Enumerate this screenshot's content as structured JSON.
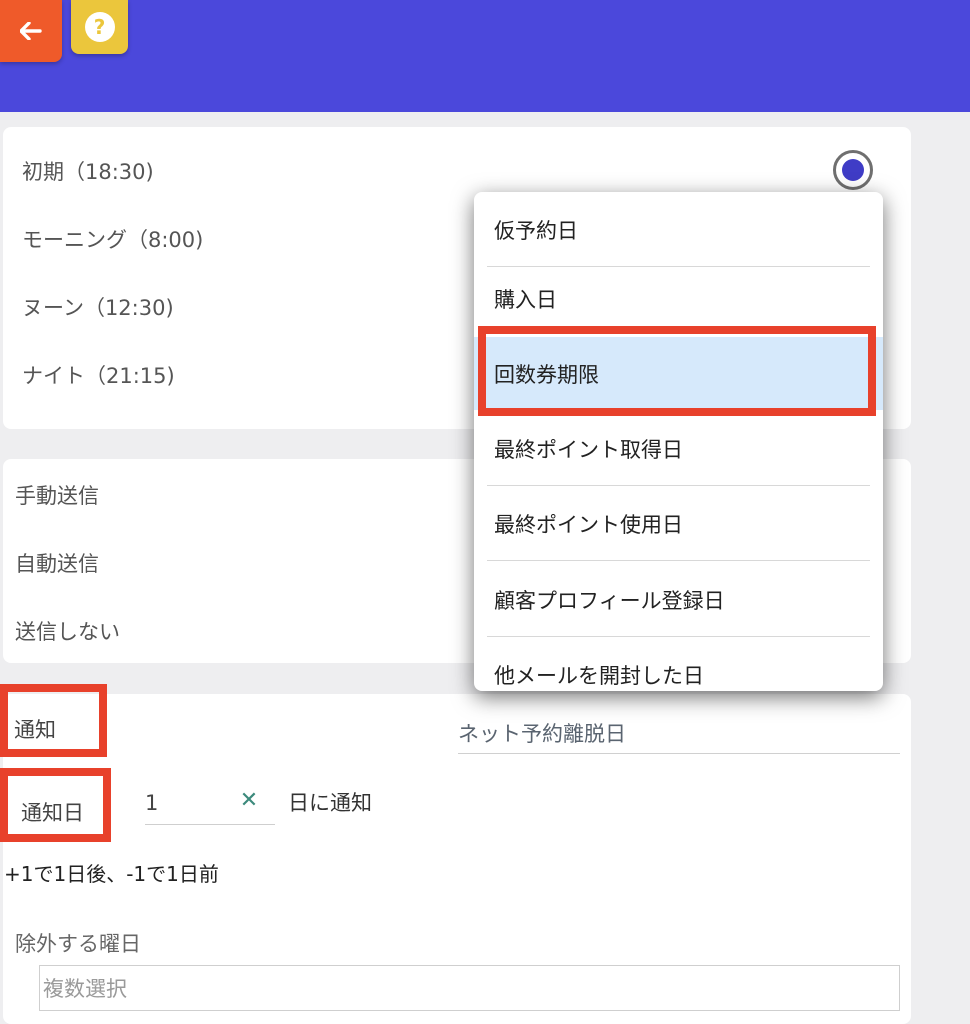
{
  "header": {
    "back_icon": "arrow-left-icon",
    "help_icon": "question-circle-icon",
    "help_glyph": "?",
    "colors": {
      "bar": "#4b48db",
      "back": "#ef5a2a",
      "help": "#ebc63c"
    }
  },
  "timing_options": [
    {
      "label": "初期（18:30)",
      "selected": true
    },
    {
      "label": "モーニング（8:00)",
      "selected": false
    },
    {
      "label": "ヌーン（12:30)",
      "selected": false
    },
    {
      "label": "ナイト（21:15)",
      "selected": false
    }
  ],
  "send_options": [
    {
      "label": "手動送信"
    },
    {
      "label": "自動送信"
    },
    {
      "label": "送信しない"
    }
  ],
  "dropdown": {
    "items": [
      {
        "label": "仮予約日"
      },
      {
        "label": "購入日"
      },
      {
        "label": "回数券期限",
        "selected": true
      },
      {
        "label": "最終ポイント取得日"
      },
      {
        "label": "最終ポイント使用日"
      },
      {
        "label": "顧客プロフィール登録日"
      },
      {
        "label": "他メールを開封した日"
      }
    ],
    "highlight_color": "#d6e9fb"
  },
  "notify": {
    "label": "通知",
    "value": "ネット予約離脱日",
    "day_label": "通知日",
    "day_value": "1",
    "day_suffix": "日に通知",
    "hint": "+1で1日後、-1で1日前",
    "clear_glyph": "✕"
  },
  "exclude": {
    "label": "除外する曜日",
    "placeholder": "複数選択"
  },
  "annotation_color": "#e8412b"
}
